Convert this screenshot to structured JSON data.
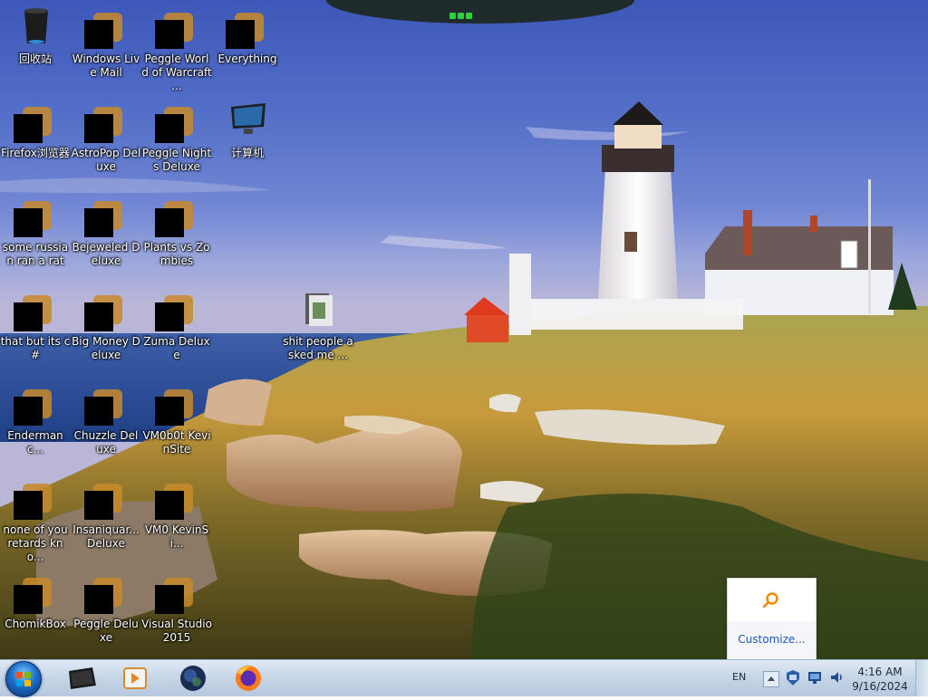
{
  "desktop": {
    "icons": [
      {
        "label": "回收站",
        "icon": "recycle-bin-icon",
        "redacted": false
      },
      {
        "label": "Windows Live Mail",
        "icon": "mail-icon",
        "redacted": true
      },
      {
        "label": "Peggle World of Warcraft ...",
        "icon": "game-icon",
        "redacted": true
      },
      {
        "label": "Everything",
        "icon": "search-icon",
        "redacted": true
      },
      {
        "label": "Firefox浏览器",
        "icon": "firefox-icon",
        "redacted": true
      },
      {
        "label": "AstroPop Deluxe",
        "icon": "game-icon",
        "redacted": true
      },
      {
        "label": "Peggle Nights Deluxe",
        "icon": "game-icon",
        "redacted": true
      },
      {
        "label": "计算机",
        "icon": "computer-icon",
        "redacted": false
      },
      {
        "label": "some russian ran a rat",
        "icon": "file-icon",
        "redacted": true
      },
      {
        "label": "Bejeweled Deluxe",
        "icon": "game-icon",
        "redacted": true
      },
      {
        "label": "Plants vs Zombies",
        "icon": "game-icon",
        "redacted": true
      },
      {
        "label": "that but its c#",
        "icon": "file-icon",
        "redacted": true
      },
      {
        "label": "Big Money Deluxe",
        "icon": "game-icon",
        "redacted": true
      },
      {
        "label": "Zuma Deluxe",
        "icon": "game-icon",
        "redacted": true
      },
      {
        "label": "shit people asked me ...",
        "icon": "folder-icon",
        "redacted": false
      },
      {
        "label": "Endermanc...",
        "icon": "app-icon",
        "redacted": true
      },
      {
        "label": "Chuzzle Deluxe",
        "icon": "game-icon",
        "redacted": true
      },
      {
        "label": "VM0b0t KevinSite",
        "icon": "app-icon",
        "redacted": true
      },
      {
        "label": "none of you retards kno...",
        "icon": "app-icon",
        "redacted": true
      },
      {
        "label": "Insaniquar... Deluxe",
        "icon": "game-icon",
        "redacted": true
      },
      {
        "label": "VM0 KevinSi...",
        "icon": "app-icon",
        "redacted": true
      },
      {
        "label": "ChomikBox",
        "icon": "app-icon",
        "redacted": true
      },
      {
        "label": "Peggle Deluxe",
        "icon": "game-icon",
        "redacted": true
      },
      {
        "label": "Visual Studio 2015",
        "icon": "visual-studio-icon",
        "redacted": true
      }
    ]
  },
  "tray_popup": {
    "customize_label": "Customize..."
  },
  "taskbar": {
    "pinned": [
      "file-explorer-icon",
      "media-player-icon",
      "globe-icon",
      "firefox-icon"
    ],
    "language": "EN",
    "time": "4:16 AM",
    "date": "9/16/2024"
  }
}
